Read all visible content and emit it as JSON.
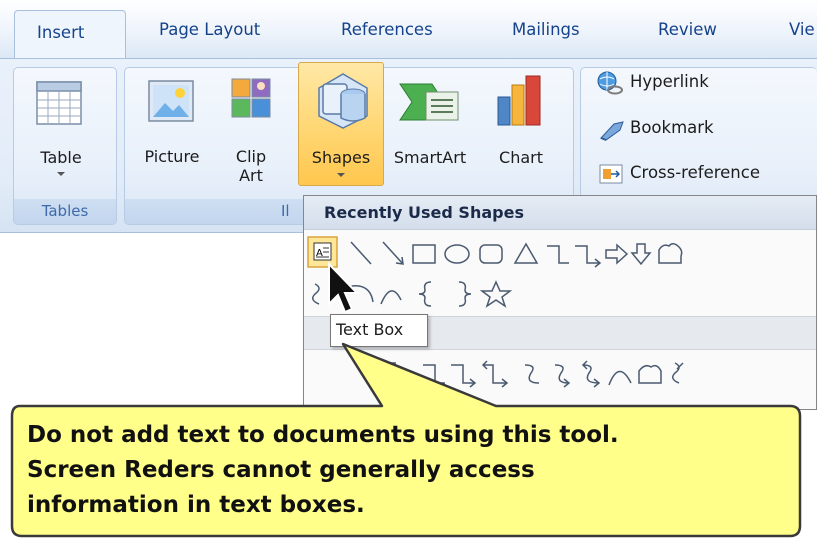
{
  "tabs": [
    {
      "label": "Insert",
      "active": true
    },
    {
      "label": "Page Layout"
    },
    {
      "label": "References"
    },
    {
      "label": "Mailings"
    },
    {
      "label": "Review"
    },
    {
      "label": "Vie"
    }
  ],
  "groups": {
    "tables": {
      "label": "Tables",
      "table_button": "Table"
    },
    "illustrations": {
      "label": "Il",
      "picture": "Picture",
      "clip_art_line1": "Clip",
      "clip_art_line2": "Art",
      "shapes": "Shapes",
      "smartart": "SmartArt",
      "chart": "Chart"
    },
    "links": {
      "hyperlink": "Hyperlink",
      "bookmark": "Bookmark",
      "cross_reference": "Cross-reference"
    }
  },
  "shapes_menu": {
    "header": "Recently Used Shapes",
    "row1_icons": [
      "text-box-icon",
      "line-icon",
      "arrow-line-icon",
      "rectangle-icon",
      "oval-icon",
      "rounded-rectangle-icon",
      "triangle-icon",
      "elbow-connector-icon",
      "elbow-arrow-connector-icon",
      "right-arrow-icon",
      "down-arrow-icon",
      "flowchart-icon"
    ],
    "row2_icons": [
      "freeform-icon",
      "arc-icon",
      "curve-icon",
      "left-brace-icon",
      "right-brace-icon",
      "star-icon"
    ],
    "tooltip": "Text Box"
  },
  "callout": {
    "line1": "Do not add text to documents using this tool.",
    "line2": "Screen Reders cannot generally access",
    "line3": "information in text boxes."
  },
  "colors": {
    "tab_text": "#15428b",
    "shapes_highlight": "#ffd877",
    "callout_fill": "#ffff8a"
  }
}
